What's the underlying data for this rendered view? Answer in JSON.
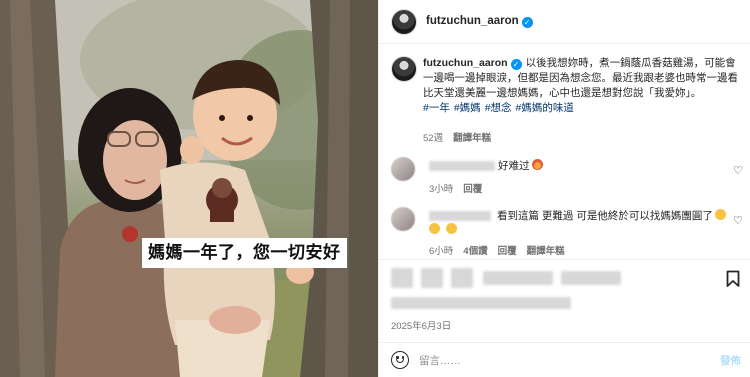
{
  "photo": {
    "subtitle": "媽媽一年了，您一切安好"
  },
  "header": {
    "username": "futzuchun_aaron",
    "verified_icon": "verified-badge-icon"
  },
  "caption": {
    "username": "futzuchun_aaron",
    "text": "以後我想妳時，煮一鍋蔭瓜香菇雞湯，可能會一邊喝一邊掉眼淚，但都是因為想念您。最近我跟老婆也時常一邊看比天堂還美麗一邊想媽媽，心中也還是想對您說「我愛妳」。",
    "hashtags": [
      "#一年",
      "#媽媽",
      "#想念",
      "#媽媽的味道"
    ],
    "time": "52週",
    "translate": "翻譯年糕"
  },
  "comments": [
    {
      "text": "好难过",
      "time": "3小時",
      "reply": "回覆"
    },
    {
      "text": "看到這篇 更難過 可是他終於可以找媽媽團圓了",
      "time": "6小時",
      "likes": "4個讚",
      "reply": "回覆",
      "translate": "翻譯年糕"
    }
  ],
  "footer": {
    "date": "2025年6月3日",
    "placeholder": "留言……",
    "post_label": "發佈",
    "icons": [
      "bookmark-icon",
      "emoji-icon",
      "heart-icon"
    ]
  },
  "colors": {
    "link": "#00376b",
    "verified": "#0095f6",
    "post_disabled": "#b2dffc",
    "meta": "#737373"
  }
}
